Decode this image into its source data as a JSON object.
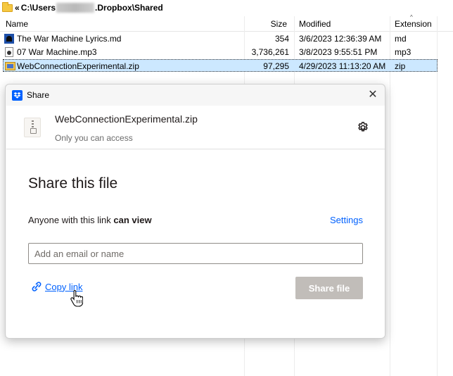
{
  "explorer": {
    "path": {
      "chevron": "«",
      "start": "C:\\Users",
      "end": ".Dropbox\\Shared"
    },
    "columns": {
      "name": "Name",
      "size": "Size",
      "modified": "Modified",
      "extension": "Extension",
      "sort_indicator": "^"
    },
    "files": [
      {
        "name": "The War Machine Lyrics.md",
        "size": "354",
        "modified": "3/6/2023 12:36:39 AM",
        "extension": "md",
        "icon": "markdown-file-icon"
      },
      {
        "name": "07 War Machine.mp3",
        "size": "3,736,261",
        "modified": "3/8/2023 9:55:51 PM",
        "extension": "mp3",
        "icon": "audio-file-icon"
      },
      {
        "name": "WebConnectionExperimental.zip",
        "size": "97,295",
        "modified": "4/29/2023 11:13:20 AM",
        "extension": "zip",
        "icon": "zip-file-icon",
        "selected": true
      }
    ]
  },
  "dialog": {
    "title": "Share",
    "close": "✕",
    "file": {
      "name": "WebConnectionExperimental.zip",
      "access": "Only you can access"
    },
    "heading": "Share this file",
    "permission_prefix": "Anyone with this link ",
    "permission_bold": "can view",
    "settings_label": "Settings",
    "email_placeholder": "Add an email or name",
    "email_value": "",
    "copy_link_label": "Copy link",
    "share_button_label": "Share file",
    "colors": {
      "accent": "#0061fe",
      "share_button_disabled": "#c1bdb9"
    }
  }
}
